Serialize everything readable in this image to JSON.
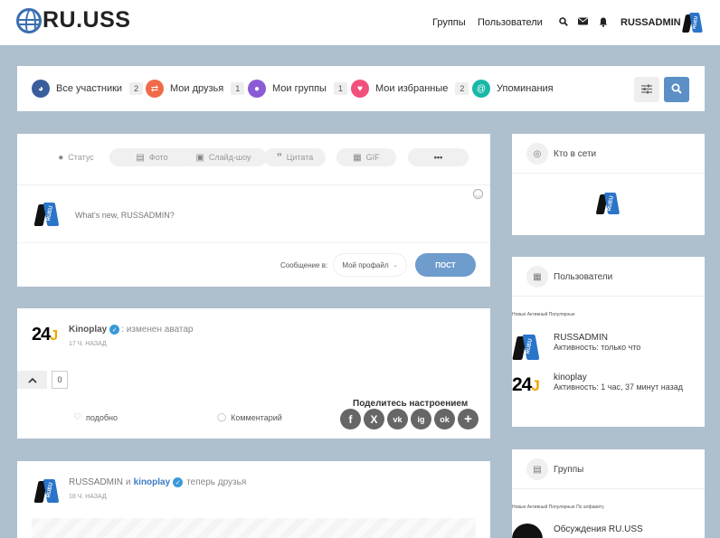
{
  "header": {
    "logo_text": "RU.USS",
    "nav": [
      "Группы",
      "Пользователи"
    ],
    "username": "RUSSADMIN",
    "icons": [
      "search-icon",
      "envelope-icon",
      "bell-icon"
    ]
  },
  "filters": {
    "items": [
      {
        "label": "Все участники",
        "count": "2",
        "color": "#3a5d9c",
        "icon": "globe-icon"
      },
      {
        "label": "Мои друзья",
        "count": "1",
        "color": "#f06a4a",
        "icon": "handshake-icon"
      },
      {
        "label": "Мои группы",
        "count": "1",
        "color": "#8b5bd6",
        "icon": "group-icon"
      },
      {
        "label": "Мои избранные",
        "count": "2",
        "color": "#f24f7b",
        "icon": "heart-icon"
      },
      {
        "label": "Упоминания",
        "count": "",
        "color": "#19b8a8",
        "icon": "at-icon"
      }
    ]
  },
  "post_form": {
    "tabs": [
      "Статус",
      "Фото",
      "Слайд-шоу",
      "Цитата",
      "GIF",
      "•••"
    ],
    "placeholder": "What's new, RUSSADMIN?",
    "post_in_label": "Сообщение в:",
    "post_in_value": "Мой профайл",
    "submit": "ПОСТ"
  },
  "activity1": {
    "user": "Kinoplay",
    "action": ": изменен аватар",
    "time": "17 Ч. НАЗАД",
    "vote_count": "0",
    "like": "подобно",
    "comment": "Комментарий",
    "share_title": "Поделитесь настроением",
    "share_icons": [
      "f",
      "X",
      "vk",
      "ig",
      "ok",
      "+"
    ]
  },
  "activity2": {
    "user1": "RUSSADMIN",
    "and": "и",
    "user2": "kinoplay",
    "action": "теперь друзья",
    "time": "18 Ч. НАЗАД"
  },
  "widgets": {
    "online": {
      "title": "Кто в сети"
    },
    "users": {
      "title": "Пользователи",
      "tabs": "Новые Активный Популярные",
      "list": [
        {
          "name": "RUSSADMIN",
          "activity": "Активность: только что"
        },
        {
          "name": "kinoplay",
          "activity": "Активность: 1 час, 37 минут назад"
        }
      ]
    },
    "groups": {
      "title": "Группы",
      "tabs": "Новые Активный Популярные По алфавиту",
      "list": [
        {
          "name": "Обсуждения RU.USS"
        }
      ]
    }
  }
}
